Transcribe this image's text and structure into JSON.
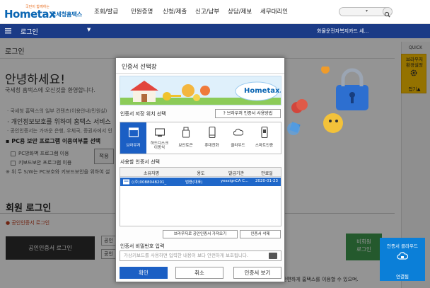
{
  "header": {
    "logo_brand": "Hometax",
    "logo_ko": "국세청홈택스",
    "logo_slogan": "국민이 함께하는",
    "nav": [
      "조회/발급",
      "민원증명",
      "신청/제출",
      "신고/납부",
      "상담/제보",
      "세무대리인"
    ],
    "search_scope": "▾"
  },
  "subbar": {
    "title": "로그인",
    "notice": "화물운전자복지카드 세..."
  },
  "main": {
    "page_title": "로그인",
    "hello": "안녕하세요!",
    "welcome": "국세청 홈택스에 오신것을 환영합니다.",
    "bullets": [
      "· 국세청 홈택스의 일부 컨텐츠(이용안내/민원실)",
      "· 개인정보보호를 위하여 홈택스 서비스",
      "· 공인인증서는 가까운 은행, 우체국, 증권사에서 인"
    ],
    "pc_program_title": "▪ PC용 보안 프로그램 이용여부를 선택",
    "pc_options": [
      "PC방화벽 프로그램 이용",
      "키보드보안 프로그램 이용"
    ],
    "apply_button": "적용",
    "footnote": "※ 위 두 S/W는 PC보호와 키보드보안을 위하여 설",
    "member_title": "회원 로그인",
    "cert_login_label": "● 공인인증서 로그인",
    "cert_login_button": "공인인증서 로그인",
    "small_buttons": [
      "공인",
      "공인"
    ],
    "bio_button_line1": "비회원",
    "bio_button_line2": "로그인",
    "bottom_text": "간편하게 홈택스를 이용할 수 있으며."
  },
  "quick": {
    "label": "QUICK",
    "box_line1": "브라우저",
    "box_line2": "환경설정",
    "box_bottom": "접기▲"
  },
  "cloud": {
    "line1": "인증서 클라우드",
    "line2": "연결됨"
  },
  "dialog": {
    "title": "인증서 선택창",
    "banner_brand": "Hometax.",
    "location_label": "인증서 저장 위치 선택",
    "browser_help": "? 브라우저 인증서 사용방법",
    "storage": [
      {
        "label": "브라우저"
      },
      {
        "label": "하드디스크\n이동식"
      },
      {
        "label": "보안토큰"
      },
      {
        "label": "휴대전화"
      },
      {
        "label": "클라우드"
      },
      {
        "label": "스마트인증"
      }
    ],
    "select_label": "사용할 인증서 선택",
    "columns": [
      "소유자명",
      "용도",
      "발급기관",
      "만료일"
    ],
    "rows": [
      {
        "owner": "((주)0088048201_",
        "usage": "범용(대표)",
        "issuer": "yessignCA C...",
        "expiry": "2020-01-23"
      }
    ],
    "import_button": "브라우저로 공인인증서 가져오기",
    "delete_button": "인증서 삭제",
    "pw_label": "인증서 비밀번호 입력",
    "pw_placeholder": "가상키보드를 사용하면 입력한 내용이 보다 안전하게 보호됩니다.",
    "ok_button": "확인",
    "cancel_button": "취소",
    "view_button": "인증서 보기"
  }
}
